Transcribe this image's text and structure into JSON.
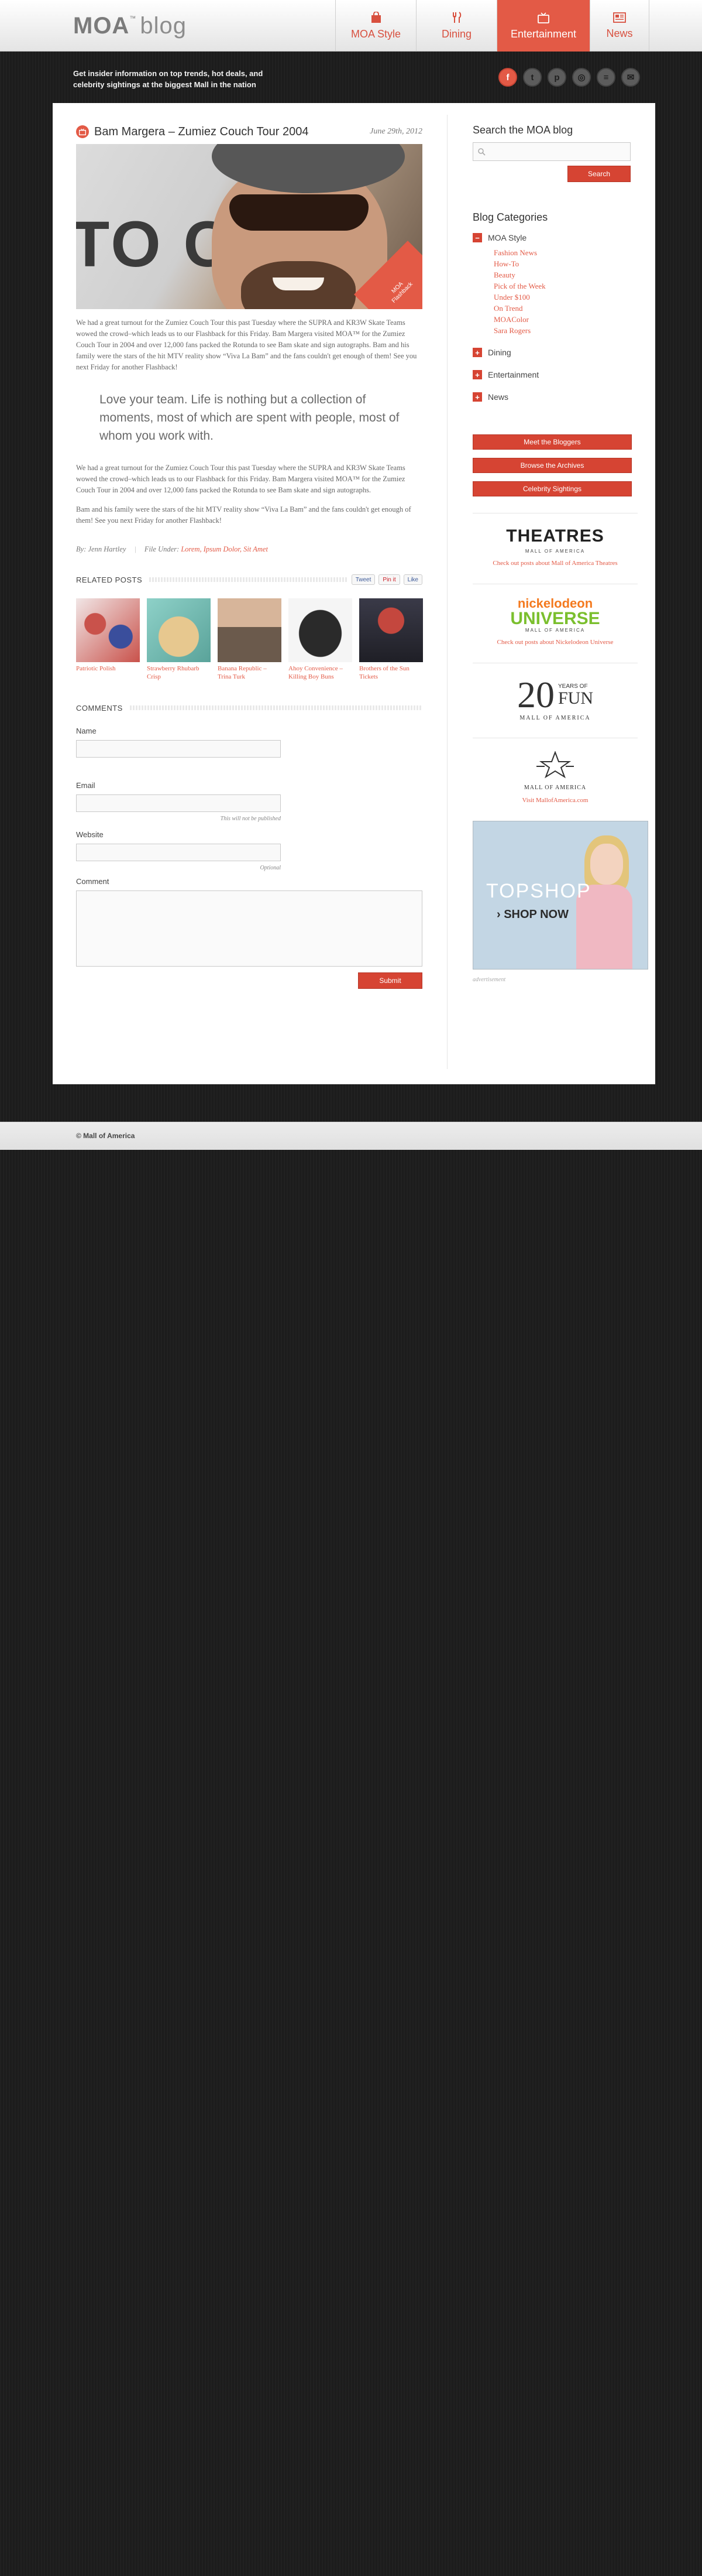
{
  "header": {
    "logo_moa": "MOA",
    "logo_tm": "™",
    "logo_blog": "blog",
    "nav": [
      {
        "label": "MOA Style",
        "icon": "shopping-bag-icon",
        "active": false
      },
      {
        "label": "Dining",
        "icon": "fork-knife-icon",
        "active": false
      },
      {
        "label": "Entertainment",
        "icon": "tv-icon",
        "active": true
      },
      {
        "label": "News",
        "icon": "newspaper-icon",
        "active": false
      }
    ],
    "tagline": "Get insider information on top trends, hot deals, and celebrity sightings at the biggest Mall in the nation",
    "social": [
      {
        "name": "facebook-icon",
        "glyph": "f"
      },
      {
        "name": "twitter-icon",
        "glyph": "t"
      },
      {
        "name": "pinterest-icon",
        "glyph": "p"
      },
      {
        "name": "instagram-icon",
        "glyph": "◎"
      },
      {
        "name": "rss-icon",
        "glyph": "≡"
      },
      {
        "name": "email-icon",
        "glyph": "✉"
      }
    ]
  },
  "post": {
    "title": "Bam Margera – Zumiez Couch Tour 2004",
    "date": "June 29th, 2012",
    "image_ribbon": "MOA Flashback",
    "image_bg_text": "TO CKW",
    "paragraph1": "We had a great turnout for the Zumiez Couch Tour this past Tuesday where the SUPRA and KR3W Skate Teams wowed the crowd–which leads us to our Flashback for this Friday. Bam Margera visited MOA™ for the Zumiez Couch Tour in 2004 and over 12,000 fans packed the Rotunda to see Bam skate and sign autographs. Bam and his family were the stars of the hit MTV reality show “Viva La Bam” and the fans couldn't get enough of them! See you next Friday for another Flashback!",
    "quote": "Love your team. Life is nothing but a collection of moments, most of which are spent with people, most of whom you work with.",
    "paragraph2": "We had a great turnout for the Zumiez Couch Tour this past Tuesday where the SUPRA and KR3W Skate Teams wowed the crowd–which leads us to our Flashback for this Friday. Bam Margera visited MOA™ for the Zumiez Couch Tour in 2004 and over 12,000 fans packed the Rotunda to see Bam skate and sign autographs.",
    "paragraph3": "Bam and his family were the stars of the hit MTV reality show “Viva La Bam” and the fans couldn't get enough of them! See you next Friday for another Flashback!",
    "meta_by": "By: Jenn Hartley",
    "meta_filed_label": "File Under:",
    "meta_tags": "Lorem, Ipsum Dolor, Sit Amet"
  },
  "related": {
    "heading": "RELATED POSTS",
    "share": {
      "tweet": "Tweet",
      "pin": "Pin it",
      "like": "Like"
    },
    "items": [
      {
        "caption": "Patriotic Polish",
        "color1": "#c9524b",
        "color2": "#3a4e9c"
      },
      {
        "caption": "Strawberry Rhubarb Crisp",
        "color1": "#8ed1c8",
        "color2": "#d05a5a"
      },
      {
        "caption": "Banana Republic – Trina Turk",
        "color1": "#6b5a4c",
        "color2": "#d7b59a"
      },
      {
        "caption": "Ahoy Convenience – Killing Boy Buns",
        "color1": "#f5f5f5",
        "color2": "#2a2a2a"
      },
      {
        "caption": "Brothers of the Sun Tickets",
        "color1": "#3a3a48",
        "color2": "#c4473e"
      }
    ]
  },
  "comments": {
    "heading": "COMMENTS",
    "name_label": "Name",
    "email_label": "Email",
    "email_hint": "This will not be published",
    "website_label": "Website",
    "website_hint": "Optional",
    "comment_label": "Comment",
    "submit_label": "Submit"
  },
  "sidebar": {
    "search_title": "Search the MOA blog",
    "search_placeholder": "",
    "search_button": "Search",
    "categories_title": "Blog Categories",
    "categories": [
      {
        "label": "MOA Style",
        "toggle": "−",
        "expanded": true
      },
      {
        "label": "Dining",
        "toggle": "+",
        "expanded": false
      },
      {
        "label": "Entertainment",
        "toggle": "+",
        "expanded": false
      },
      {
        "label": "News",
        "toggle": "+",
        "expanded": false
      }
    ],
    "subcategories": [
      "Fashion News",
      "How-To",
      "Beauty",
      "Pick of the Week",
      "Under $100",
      "On Trend",
      "MOAColor",
      "Sara Rogers"
    ],
    "buttons": [
      "Meet the Bloggers",
      "Browse the Archives",
      "Celebrity Sightings"
    ],
    "promos": [
      {
        "logo": "THEATRES",
        "sub": "MALL OF AMERICA",
        "link": "Check out posts about Mall of America Theatres"
      },
      {
        "logo1": "nickelodeon",
        "logo2": "UNIVERSE",
        "sub": "MALL OF AMERICA",
        "link": "Check out posts about Nickelodeon Universe"
      },
      {
        "big": "20",
        "side1": "YEARS OF",
        "side2": "FUN",
        "sub": "MALL OF AMERICA"
      },
      {
        "sub": "MALL OF AMERICA",
        "link": "Visit MallofAmerica.com"
      }
    ],
    "ad": {
      "brand": "TOPSHOP",
      "cta": "› SHOP NOW",
      "label": "advertisement"
    }
  },
  "footer": {
    "copyright": "© Mall of America"
  },
  "colors": {
    "accent": "#e35a46",
    "button": "#d64433",
    "page_bg": "#1c1c1c"
  }
}
